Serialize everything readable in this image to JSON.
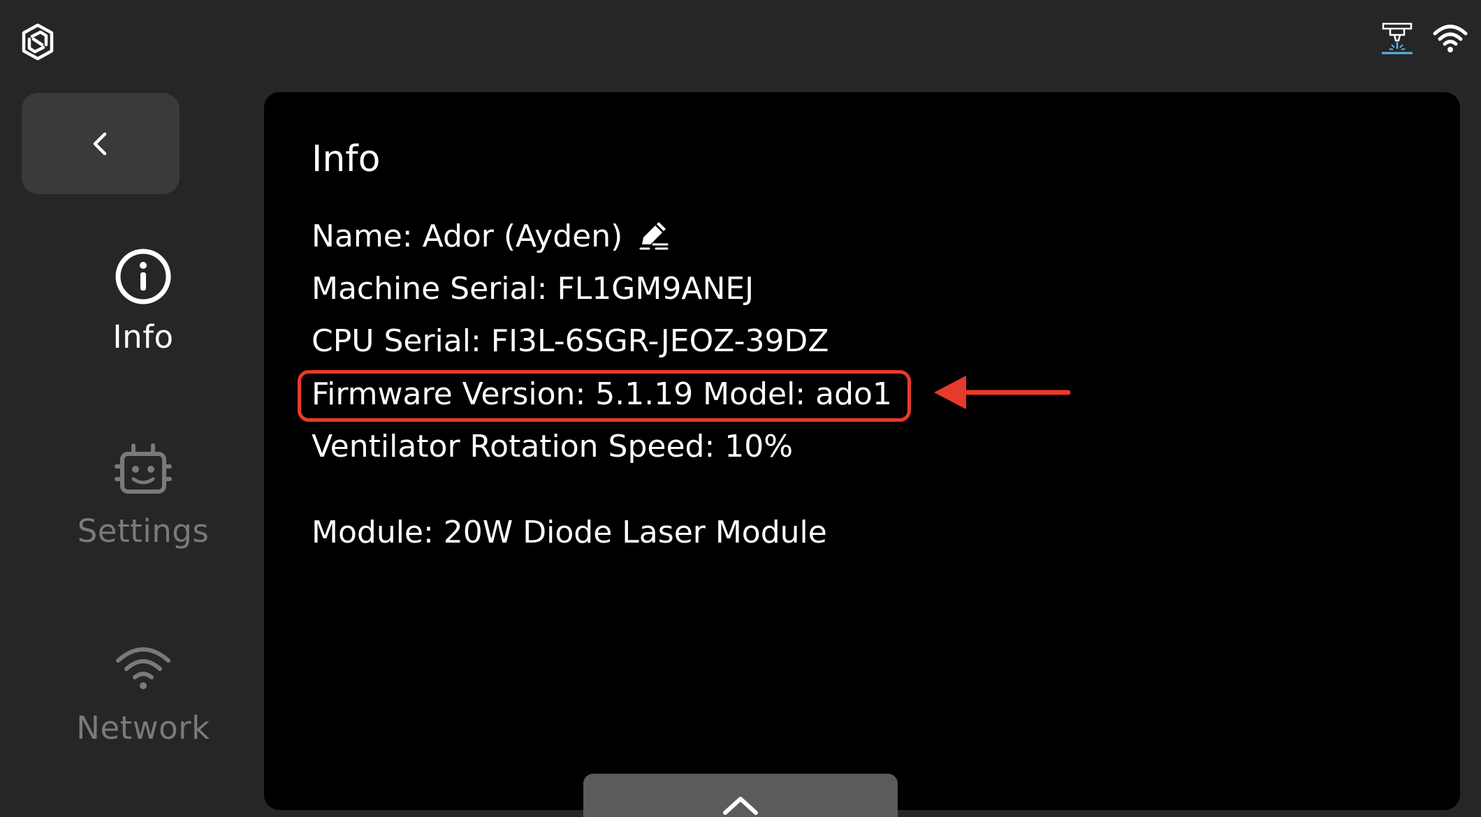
{
  "header": {
    "logo_icon": "brand-logo-icon",
    "status_icons": [
      "laser-machine-icon",
      "wifi-icon"
    ]
  },
  "sidebar": {
    "back_icon": "chevron-left-icon",
    "items": [
      {
        "label": "Info",
        "icon": "info-icon",
        "active": true
      },
      {
        "label": "Settings",
        "icon": "robot-icon",
        "active": false
      },
      {
        "label": "Network",
        "icon": "wifi-icon",
        "active": false
      }
    ]
  },
  "panel": {
    "title": "Info",
    "name_line": "Name: Ador (Ayden)",
    "machine_serial_line": "Machine Serial: FL1GM9ANEJ",
    "cpu_serial_line": "CPU Serial: FI3L-6SGR-JEOZ-39DZ",
    "firmware_line": "Firmware Version: 5.1.19 Model: ado1",
    "ventilator_line": "Ventilator Rotation Speed: 10%",
    "module_line": "Module: 20W Diode Laser Module"
  },
  "annotation": {
    "highlight_color": "#e83a2a"
  },
  "bottom_tab": {
    "icon": "chevron-up-icon"
  },
  "colors": {
    "background": "#262626",
    "panel": "#000000",
    "button": "#3a3a3c",
    "inactive_text": "#7a7a7a",
    "bottom_tab": "#5a5b5d"
  }
}
